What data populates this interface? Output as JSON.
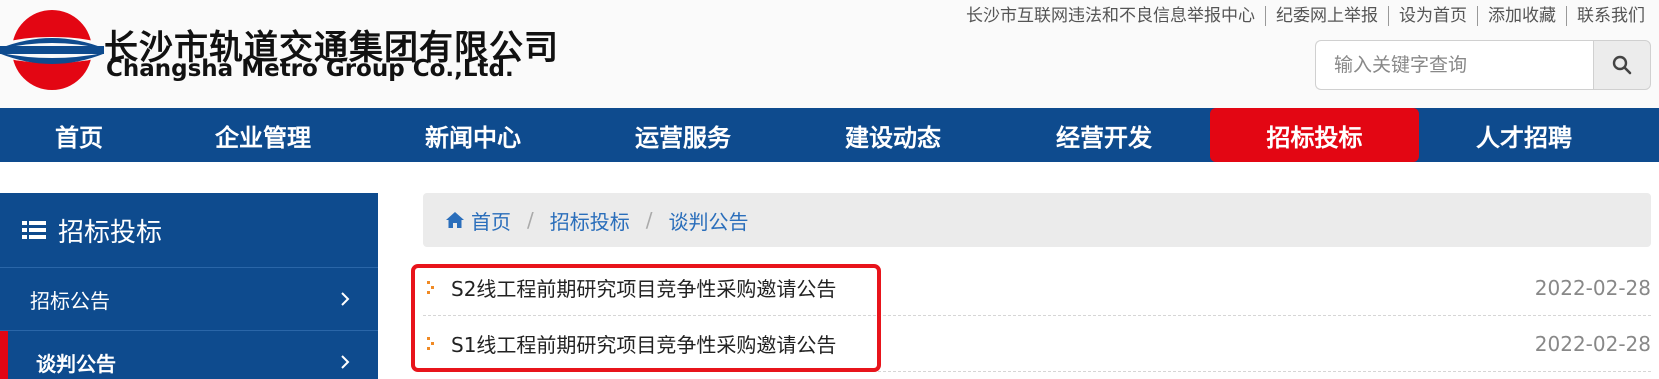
{
  "header": {
    "logo_cn": "长沙市轨道交通集团有限公司",
    "logo_en": "Changsha Metro Group Co.,Ltd.",
    "top_links": [
      "长沙市互联网违法和不良信息举报中心",
      "纪委网上举报",
      "设为首页",
      "添加收藏",
      "联系我们"
    ],
    "search": {
      "placeholder": "输入关键字查询",
      "icon": "search-icon"
    }
  },
  "nav": {
    "items": [
      "首页",
      "企业管理",
      "新闻中心",
      "运营服务",
      "建设动态",
      "经营开发",
      "招标投标",
      "人才招聘"
    ],
    "active": "招标投标"
  },
  "sidebar": {
    "title": "招标投标",
    "title_icon": "list-icon",
    "items": [
      {
        "label": "招标公告",
        "active": false
      },
      {
        "label": "谈判公告",
        "active": true
      }
    ]
  },
  "breadcrumb": {
    "home_icon": "home-icon",
    "items": [
      "首页",
      "招标投标",
      "谈判公告"
    ]
  },
  "list": {
    "rows": [
      {
        "title": "S2线工程前期研究项目竞争性采购邀请公告",
        "date": "2022-02-28"
      },
      {
        "title": "S1线工程前期研究项目竞争性采购邀请公告",
        "date": "2022-02-28"
      }
    ]
  },
  "colors": {
    "brand_blue": "#0e4b8e",
    "accent_red": "#e30613",
    "link_blue": "#2a6ebb",
    "highlight_red": "#e8141b"
  }
}
